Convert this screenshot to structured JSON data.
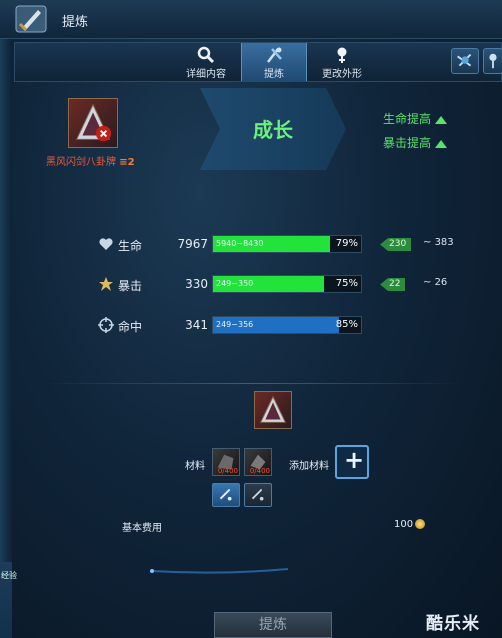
{
  "window": {
    "title": "提炼"
  },
  "tabs": [
    {
      "label": "详细内容",
      "icon": "magnifier-icon",
      "active": false
    },
    {
      "label": "提炼",
      "icon": "refine-tools-icon",
      "active": true
    },
    {
      "label": "更改外形",
      "icon": "change-appearance-icon",
      "active": false
    }
  ],
  "item": {
    "name": "黑风闪剑八卦牌",
    "grade": "≡2"
  },
  "banner": {
    "text": "成长"
  },
  "gains": [
    "生命提高",
    "暴击提高"
  ],
  "stats": [
    {
      "label": "生命",
      "icon": "heart-icon",
      "value": "7967",
      "range": "5940~8430",
      "percent": 79,
      "percent_text": "79%",
      "color": "#22e33a",
      "gain_tag": "230",
      "gain_max": "383"
    },
    {
      "label": "暴击",
      "icon": "crit-star-icon",
      "value": "330",
      "range": "249~350",
      "percent": 75,
      "percent_text": "75%",
      "color": "#22e33a",
      "gain_tag": "22",
      "gain_max": "26"
    },
    {
      "label": "命中",
      "icon": "crosshair-icon",
      "value": "341",
      "range": "249~356",
      "percent": 85,
      "percent_text": "85%",
      "color": "#1f6fc2",
      "gain_tag": "",
      "gain_max": ""
    }
  ],
  "materials": {
    "label": "材料",
    "slot_counts": [
      "0/400",
      "0/400"
    ],
    "add_label": "添加材料"
  },
  "cost": {
    "label": "基本费用",
    "value": "100"
  },
  "refine_button": {
    "label": "提炼"
  },
  "watermark": "酷乐米",
  "side_text": "经验",
  "colors": {
    "accent_green": "#58e46a",
    "item_name": "#f15a3a",
    "bar_blue": "#1f6fc2"
  }
}
